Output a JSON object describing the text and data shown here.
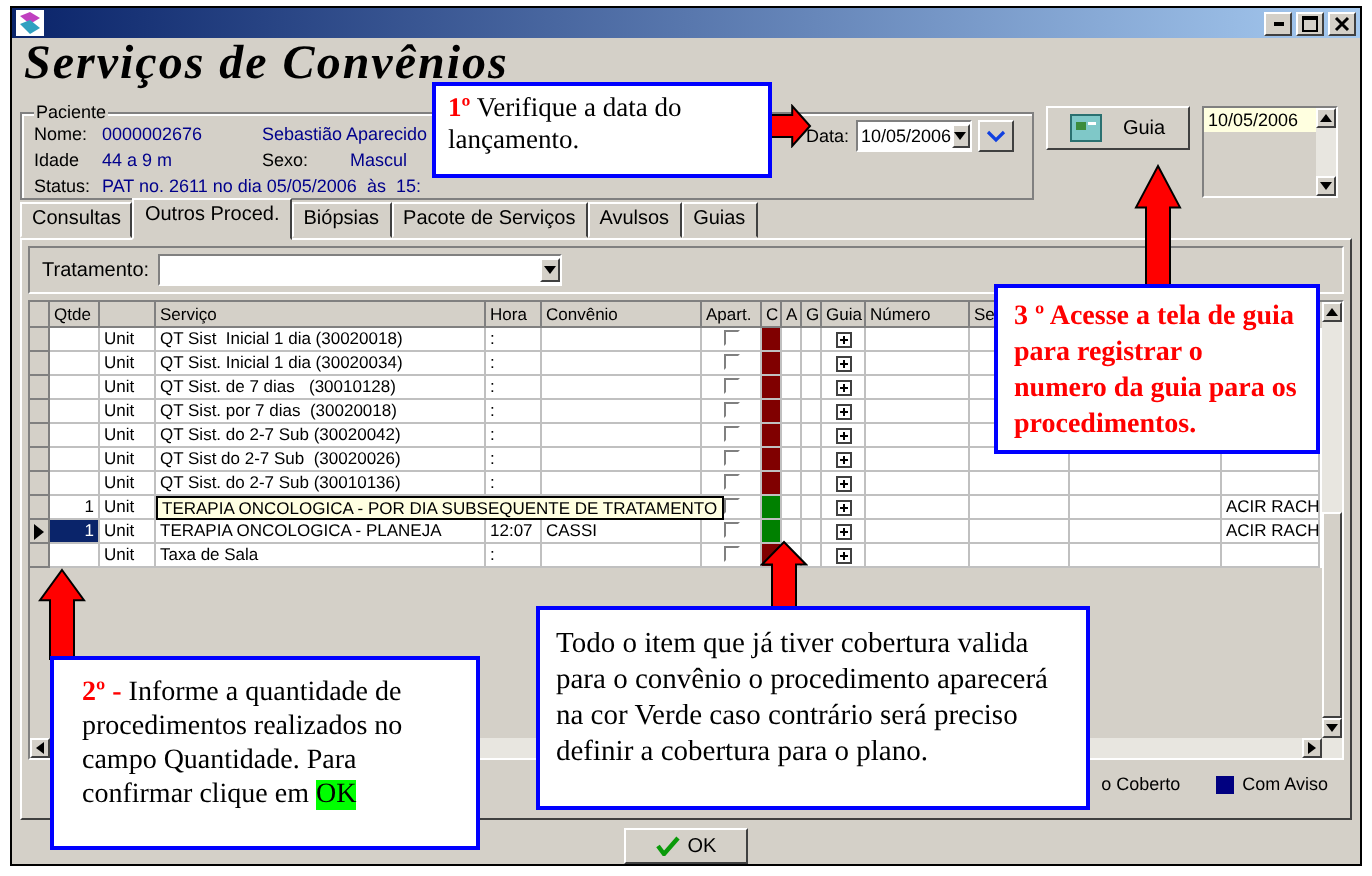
{
  "window": {
    "heading": "Serviços de Convênios"
  },
  "paciente": {
    "legend": "Paciente",
    "lines": [
      [
        {
          "kind": "label",
          "text": "Nome:"
        },
        {
          "kind": "value",
          "text": "0000002676"
        },
        {
          "kind": "value",
          "text": "Sebastião Aparecido"
        }
      ],
      [
        {
          "kind": "label",
          "text": "Idade"
        },
        {
          "kind": "value",
          "text": "44 a 9 m"
        },
        {
          "kind": "label",
          "text": "Sexo:"
        },
        {
          "kind": "value",
          "text": "Mascul"
        }
      ],
      [
        {
          "kind": "label",
          "text": "Status:"
        },
        {
          "kind": "value",
          "text": "PAT no. 2611 no dia 05/05/2006  às  15:"
        }
      ]
    ]
  },
  "data": {
    "label": "Data:",
    "value": "10/05/2006"
  },
  "guia_button": {
    "label": "Guia"
  },
  "date_list": {
    "items": [
      {
        "text": "10/05/2006",
        "selected": true
      }
    ]
  },
  "tabs": [
    {
      "label": "Consultas",
      "selected": false
    },
    {
      "label": "Outros Proced.",
      "selected": true
    },
    {
      "label": "Biópsias",
      "selected": false
    },
    {
      "label": "Pacote de Serviços",
      "selected": false
    },
    {
      "label": "Avulsos",
      "selected": false
    },
    {
      "label": "Guias",
      "selected": false
    }
  ],
  "tratamento": {
    "label": "Tratamento:"
  },
  "table": {
    "columns": [
      {
        "label": "Qtde"
      },
      {
        "label": "Serviço"
      },
      {
        "label": "Hora"
      },
      {
        "label": "Convênio"
      },
      {
        "label": "Apart."
      },
      {
        "label": "C"
      },
      {
        "label": "A"
      },
      {
        "label": "G"
      },
      {
        "label": "Guia"
      },
      {
        "label": "Número"
      },
      {
        "label": "Se"
      }
    ],
    "rows": [
      {
        "selected": false,
        "unit": "Unit",
        "servico": "QT Sist  Inicial 1 dia (30020018)",
        "expanded": false,
        "hora": ":",
        "apart": false,
        "color": "#800000"
      },
      {
        "selected": false,
        "unit": "Unit",
        "servico": "QT Sist. Inicial 1 dia (30020034)",
        "expanded": false,
        "hora": ":",
        "apart": false,
        "color": "#800000"
      },
      {
        "selected": false,
        "unit": "Unit",
        "servico": "QT Sist. de 7 dias   (30010128)",
        "expanded": false,
        "hora": ":",
        "apart": false,
        "color": "#800000"
      },
      {
        "selected": false,
        "unit": "Unit",
        "servico": "QT Sist. por 7 dias  (30020018)",
        "expanded": false,
        "hora": ":",
        "apart": false,
        "color": "#800000"
      },
      {
        "selected": false,
        "unit": "Unit",
        "servico": "QT Sist. do 2-7 Sub (30020042)",
        "expanded": false,
        "hora": ":",
        "apart": false,
        "color": "#800000"
      },
      {
        "selected": false,
        "unit": "Unit",
        "servico": "QT Sist do 2-7 Sub  (30020026)",
        "expanded": false,
        "hora": ":",
        "apart": false,
        "color": "#800000"
      },
      {
        "selected": false,
        "unit": "Unit",
        "servico": "QT Sist. do 2-7 Sub (30010136)",
        "expanded": false,
        "hora": ":",
        "apart": false,
        "color": "#800000"
      },
      {
        "selected": false,
        "qtde": "1",
        "unit": "Unit",
        "servico": "TERAPIA ONCOLOGICA - POR DIA SUBSEQUENTE DE TRATAMENTO",
        "expanded": true,
        "apart": false,
        "color": "#008000",
        "column_15": "ACIR RACH"
      },
      {
        "selected": true,
        "qtde": "1",
        "unit": "Unit",
        "servico": "TERAPIA ONCOLOGICA - PLANEJA",
        "expanded": false,
        "hora": "12:07",
        "convenio": "CASSI",
        "apart": false,
        "color": "#008000",
        "column_15": "ACIR RACH"
      },
      {
        "selected": false,
        "unit": "Unit",
        "servico": "Taxa de Sala",
        "expanded": false,
        "hora": ":",
        "apart": false,
        "color": "#800000"
      }
    ]
  },
  "legend": [
    {
      "label": "o Coberto"
    },
    {
      "label": "Com Aviso",
      "color": "#000080"
    }
  ],
  "ok_button": {
    "label": "OK"
  },
  "callouts": [
    {
      "kind": "plain",
      "lead": "1º",
      "text": "Verifique a data do lançamento."
    },
    {
      "kind": "emphasis",
      "text": "3 º Acesse a tela de guia para registrar o numero da guia para os procedimentos."
    },
    {
      "kind": "plain",
      "lead": "2º -",
      "text": "Informe a quantidade de procedimentos realizados no campo Quantidade. Para confirmar clique em",
      "highlight": "OK"
    },
    {
      "kind": "plain",
      "text": "Todo o item que já tiver cobertura valida para o convênio o procedimento aparecerá na cor Verde caso contrário será preciso definir a cobertura para o plano."
    }
  ]
}
